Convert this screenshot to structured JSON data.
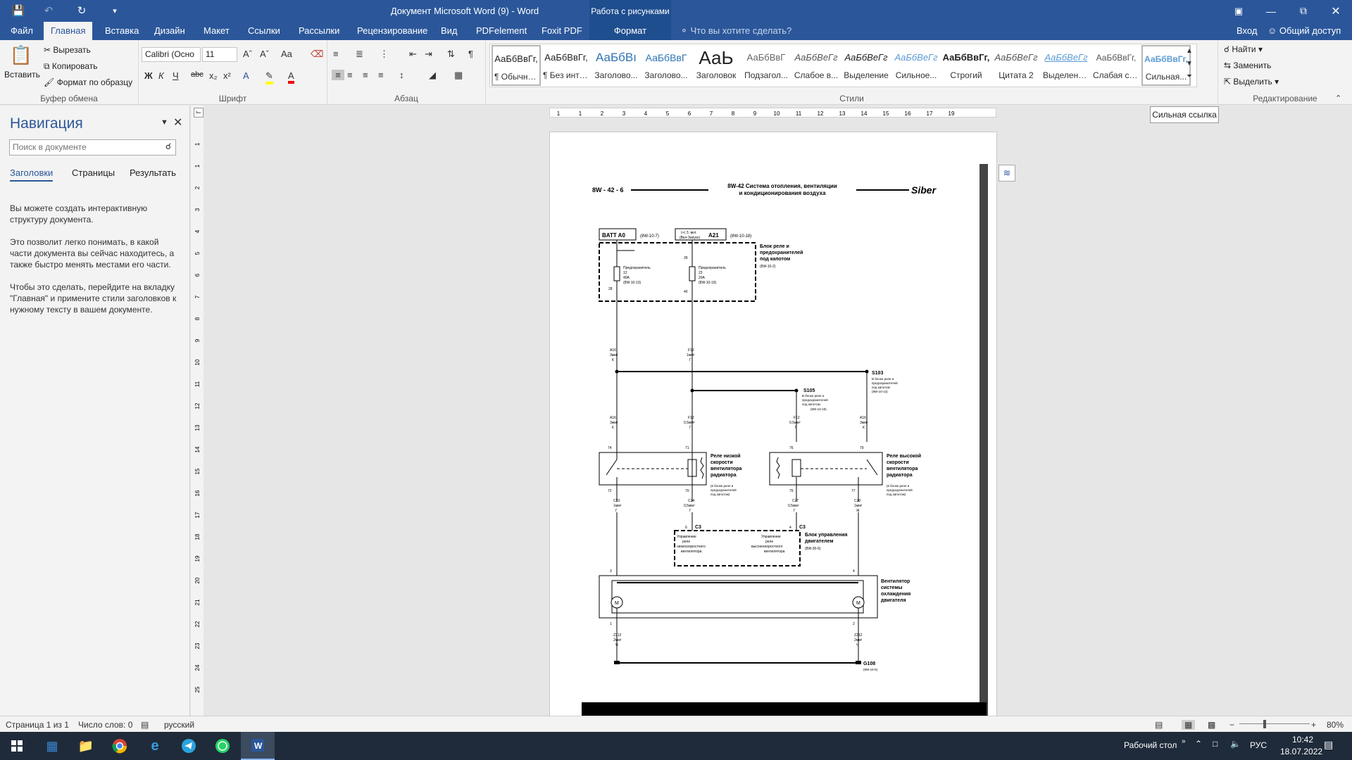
{
  "app": {
    "window_title": "Документ Microsoft Word (9) - Word",
    "context_group": "Работа с рисунками"
  },
  "tabs": [
    "Файл",
    "Главная",
    "Вставка",
    "Дизайн",
    "Макет",
    "Ссылки",
    "Рассылки",
    "Рецензирование",
    "Вид",
    "PDFelement",
    "Foxit PDF"
  ],
  "context_tab": "Формат",
  "tell_me": "Что вы хотите сделать?",
  "account": {
    "signin": "Вход",
    "share": "Общий доступ"
  },
  "ribbon": {
    "clipboard": {
      "paste": "Вставить",
      "cut": "Вырезать",
      "copy": "Копировать",
      "painter": "Формат по образцу",
      "label": "Буфер обмена"
    },
    "font": {
      "name": "Calibri (Осно",
      "size": "11",
      "label": "Шрифт",
      "case": "Aa"
    },
    "paragraph": {
      "label": "Абзац"
    },
    "styles": {
      "label": "Стили",
      "items": [
        {
          "preview": "АаБбВвГг,",
          "name": "¶ Обычный"
        },
        {
          "preview": "АаБбВвГг,",
          "name": "¶ Без инте..."
        },
        {
          "preview": "АаБбВı",
          "name": "Заголово..."
        },
        {
          "preview": "АаБбВвГ",
          "name": "Заголово..."
        },
        {
          "preview": "АаЬ",
          "name": "Заголовок"
        },
        {
          "preview": "АаБбВвГ",
          "name": "Подзагол..."
        },
        {
          "preview": "АаБбВеГг",
          "name": "Слабое в..."
        },
        {
          "preview": "АаБбВеГг",
          "name": "Выделение"
        },
        {
          "preview": "АаБбВеГг",
          "name": "Сильное..."
        },
        {
          "preview": "АаБбВвГг,",
          "name": "Строгий"
        },
        {
          "preview": "АаБбВеГг",
          "name": "Цитата 2"
        },
        {
          "preview": "АаБбВеГг",
          "name": "Выделенн..."
        },
        {
          "preview": "АаБбВвГг,",
          "name": "Слабая сс..."
        },
        {
          "preview": "АаБбВвГг,",
          "name": "Сильная..."
        }
      ]
    },
    "editing": {
      "find": "Найти",
      "replace": "Заменить",
      "select": "Выделить",
      "label": "Редактирование"
    }
  },
  "tooltip": "Сильная ссылка",
  "nav": {
    "title": "Навигация",
    "search_placeholder": "Поиск в документе",
    "tabs": [
      "Заголовки",
      "Страницы",
      "Результать"
    ],
    "hint1": "Вы можете создать интерактивную структуру документа.",
    "hint2": "Это позволит легко понимать, в какой части документа вы сейчас находитесь, а также быстро менять местами его части.",
    "hint3": "Чтобы это сделать, перейдите на вкладку \"Главная\" и примените стили заголовков к нужному тексту в вашем документе."
  },
  "ruler": {
    "h": [
      "1",
      "1",
      "2",
      "3",
      "4",
      "5",
      "6",
      "7",
      "8",
      "9",
      "10",
      "11",
      "12",
      "13",
      "14",
      "15",
      "16",
      "17",
      "19"
    ],
    "v": [
      "1",
      "1",
      "2",
      "3",
      "4",
      "5",
      "6",
      "7",
      "8",
      "9",
      "10",
      "11",
      "12",
      "13",
      "14",
      "15",
      "16",
      "17",
      "18",
      "19",
      "20",
      "21",
      "22",
      "23",
      "24",
      "25"
    ]
  },
  "diagram": {
    "code": "8W - 42 - 6",
    "title1": "8W-42 Система отопления, вентиляции",
    "title2": "и кондиционирования воздуха",
    "logo": "Siber",
    "batt": "BATT A0",
    "batt_ref": "(8W-10-7)",
    "a21_top": "(+) З. вкл.",
    "a21_sub": "(Вкл-Запуск)",
    "a21": "A21",
    "a21_ref": "(8W-10-18)",
    "relay_box1": "Блок реле и",
    "relay_box2": "предохранителей",
    "relay_box3": "под капотом",
    "relay_box_ref": "(8W-10-2)",
    "fuse_a": "Предохранитель",
    "fuse1_n": "12",
    "fuse1_a": "40A",
    "fuse1_ref": "(8W-10-13)",
    "fuse2_n": "23",
    "fuse2_a": "20A",
    "fuse2_ref": "(8W-10-19)",
    "pin28": "28",
    "pin39": "39",
    "pin40": "40",
    "w_a16": "A16",
    "w_3mm": "3мм²",
    "w_k": "К",
    "w_f12": "F12",
    "w_1mm": "1мм²",
    "w_g": "Г",
    "s103": "S103",
    "s103_d1": "В блоке реле и",
    "s103_d2": "предохранителей",
    "s103_d3": "под капотом",
    "s103_ref": "(8W-10-13)",
    "s105": "S105",
    "s105_ref": "(8W-10-19)",
    "w_05": "0,5мм²",
    "pin74": "74",
    "pin71": "71",
    "pin76": "76",
    "pin79": "79",
    "pin72": "72",
    "pin70": "70",
    "pin75": "75",
    "pin77": "77",
    "relay_low1": "Реле низкой",
    "relay_low2": "скорости",
    "relay_low3": "вентилятора",
    "relay_low4": "радиатора",
    "relay_high1": "Реле высокой",
    "relay_high2": "скорости",
    "relay_high3": "вентилятора",
    "relay_high4": "радиатора",
    "relay_note1": "(в блоке реле и",
    "relay_note2": "предохранителей",
    "relay_note3": "под капотом)",
    "c23": "C23",
    "c24": "C24",
    "c27": "C27",
    "c20": "C20",
    "w_zh": "Ж",
    "c3": "C3",
    "pin6": "6",
    "pin4": "4",
    "ecu_low1": "Управление",
    "ecu_low2": "реле",
    "ecu_low3": "низкоскоростного",
    "ecu_low4": "вентилятора",
    "ecu_high3": "высокоскоростного",
    "ecu1": "Блок управления",
    "ecu2": "двигателем",
    "ecu_ref": "(8W-30-6)",
    "fan1": "Вентилятор",
    "fan2": "системы",
    "fan3": "охлаждения",
    "fan4": "двигателя",
    "motor": "M",
    "pin3": "3",
    "pin1": "1",
    "pin2": "2",
    "z212": "Z212",
    "w_2mm": "2мм²",
    "w_ch": "Ч",
    "g108": "G108",
    "g108_ref": "(8W-15-5)"
  },
  "status": {
    "page": "Страница 1 из 1",
    "words": "Число слов: 0",
    "lang": "русский",
    "zoom": "80%"
  },
  "taskbar": {
    "desktop": "Рабочий стол",
    "lang": "РУС",
    "time": "10:42",
    "date": "18.07.2022"
  }
}
